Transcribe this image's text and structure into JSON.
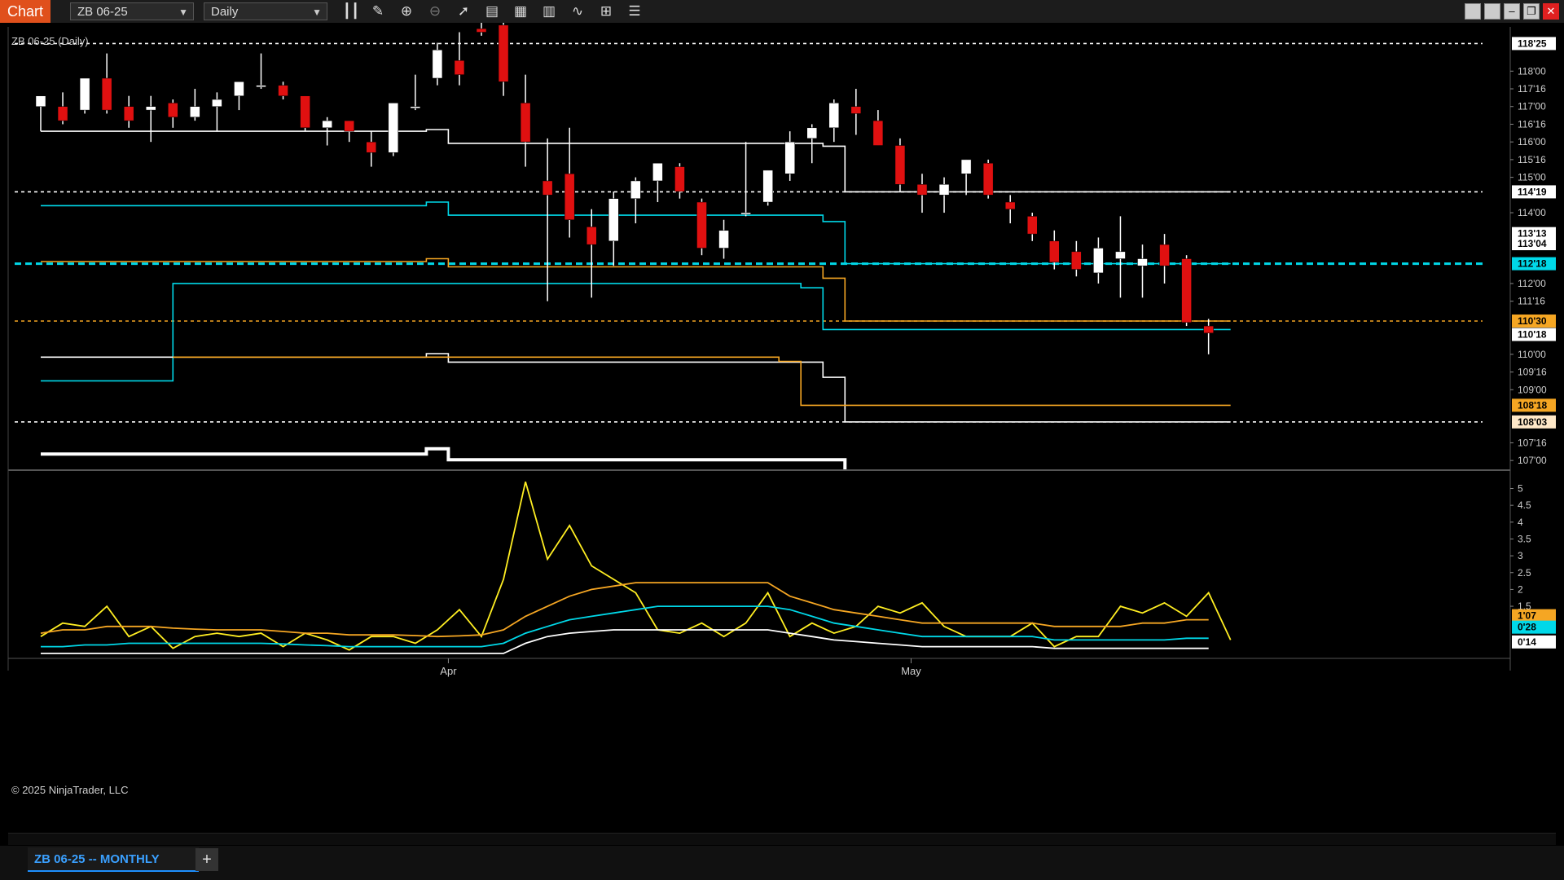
{
  "toolbar": {
    "chart_label": "Chart",
    "instrument": "ZB 06-25",
    "interval": "Daily",
    "icons": [
      "bar-type-icon",
      "draw-pencil-icon",
      "zoom-in-icon",
      "zoom-out-icon",
      "pointer-icon",
      "data-box-icon",
      "properties-icon",
      "strategies-icon",
      "indicators-icon",
      "list-icon"
    ]
  },
  "chart": {
    "title": "ZB 06-25 (Daily)",
    "copyright": "© 2025 NinjaTrader, LLC",
    "x_labels": [
      {
        "label": "Apr",
        "bar": 18.5
      },
      {
        "label": "May",
        "bar": 39.5
      }
    ],
    "price_ticks": [
      "118'00",
      "117'16",
      "117'00",
      "116'16",
      "116'00",
      "115'16",
      "115'00",
      "114'00",
      "112'00",
      "111'16",
      "110'00",
      "109'16",
      "109'00",
      "107'16",
      "107'00"
    ],
    "price_tick_values": [
      118.0,
      117.5,
      117.0,
      116.5,
      116.0,
      115.5,
      115.0,
      114.0,
      112.0,
      111.5,
      110.0,
      109.5,
      109.0,
      107.5,
      107.0
    ],
    "price_badges": [
      {
        "label": "118'25",
        "value": 118.78,
        "color": "#ffffff"
      },
      {
        "label": "114'19",
        "value": 114.59,
        "color": "#ffffff"
      },
      {
        "label": "113'13",
        "value": 113.41,
        "color": "#ffffff"
      },
      {
        "label": "113'04",
        "value": 113.125,
        "color": "#ffffff"
      },
      {
        "label": "112'18",
        "value": 112.56,
        "color": "#00d8e8"
      },
      {
        "label": "110'30",
        "value": 110.94,
        "color": "#f5a623"
      },
      {
        "label": "110'18",
        "value": 110.56,
        "color": "#ffffff"
      },
      {
        "label": "108'18",
        "value": 108.56,
        "color": "#f5a623"
      },
      {
        "label": "108'03",
        "value": 108.09,
        "color": "#ffe8c8"
      }
    ],
    "indicator_ticks": [
      "5",
      "4.5",
      "4",
      "3.5",
      "3",
      "2.5",
      "2",
      "1.5"
    ],
    "indicator_tick_values": [
      5,
      4.5,
      4,
      3.5,
      3,
      2.5,
      2,
      1.5
    ],
    "indicator_badges": [
      {
        "label": "1'07",
        "value": 1.22,
        "color": "#f5a623"
      },
      {
        "label": "0'28",
        "value": 0.88,
        "color": "#00d8e8"
      },
      {
        "label": "0'14",
        "value": 0.44,
        "color": "#ffffff"
      }
    ],
    "colors": {
      "up": "#ffffff",
      "down": "#e01010",
      "cyan": "#00d8e8",
      "orange": "#f5a623",
      "yellow": "#ffee22"
    }
  },
  "chart_data": {
    "type": "candlestick",
    "instrument": "ZB 06-25",
    "interval": "Daily",
    "price_axis_range": [
      106.75,
      119.25
    ],
    "indicator_axis_range": [
      0.0,
      5.4
    ],
    "candles": [
      {
        "o": 117.0,
        "h": 117.3,
        "l": 116.3,
        "c": 117.3
      },
      {
        "o": 117.0,
        "h": 117.4,
        "l": 116.5,
        "c": 116.6
      },
      {
        "o": 116.9,
        "h": 117.8,
        "l": 116.8,
        "c": 117.8
      },
      {
        "o": 117.8,
        "h": 118.5,
        "l": 116.8,
        "c": 116.9
      },
      {
        "o": 117.0,
        "h": 117.3,
        "l": 116.4,
        "c": 116.6
      },
      {
        "o": 116.9,
        "h": 117.3,
        "l": 116.0,
        "c": 117.0
      },
      {
        "o": 117.1,
        "h": 117.2,
        "l": 116.4,
        "c": 116.7
      },
      {
        "o": 116.7,
        "h": 117.5,
        "l": 116.6,
        "c": 117.0
      },
      {
        "o": 117.0,
        "h": 117.4,
        "l": 116.3,
        "c": 117.2
      },
      {
        "o": 117.3,
        "h": 117.7,
        "l": 116.9,
        "c": 117.7
      },
      {
        "o": 117.6,
        "h": 118.5,
        "l": 117.5,
        "c": 117.6
      },
      {
        "o": 117.6,
        "h": 117.7,
        "l": 117.2,
        "c": 117.3
      },
      {
        "o": 117.3,
        "h": 117.3,
        "l": 116.3,
        "c": 116.4
      },
      {
        "o": 116.4,
        "h": 116.7,
        "l": 115.9,
        "c": 116.6
      },
      {
        "o": 116.6,
        "h": 116.6,
        "l": 116.0,
        "c": 116.3
      },
      {
        "o": 116.0,
        "h": 116.3,
        "l": 115.3,
        "c": 115.7
      },
      {
        "o": 115.7,
        "h": 117.1,
        "l": 115.6,
        "c": 117.1
      },
      {
        "o": 117.0,
        "h": 117.9,
        "l": 116.9,
        "c": 117.0
      },
      {
        "o": 117.8,
        "h": 118.8,
        "l": 117.6,
        "c": 118.6
      },
      {
        "o": 118.3,
        "h": 119.1,
        "l": 117.6,
        "c": 117.9
      },
      {
        "o": 119.2,
        "h": 119.7,
        "l": 119.0,
        "c": 119.1
      },
      {
        "o": 119.3,
        "h": 119.6,
        "l": 117.3,
        "c": 117.7
      },
      {
        "o": 117.1,
        "h": 117.9,
        "l": 115.3,
        "c": 116.0
      },
      {
        "o": 114.9,
        "h": 116.1,
        "l": 111.5,
        "c": 114.5
      },
      {
        "o": 115.1,
        "h": 116.4,
        "l": 113.3,
        "c": 113.8
      },
      {
        "o": 113.6,
        "h": 114.1,
        "l": 111.6,
        "c": 113.1
      },
      {
        "o": 113.2,
        "h": 114.6,
        "l": 112.5,
        "c": 114.4
      },
      {
        "o": 114.4,
        "h": 115.0,
        "l": 113.7,
        "c": 114.9
      },
      {
        "o": 114.9,
        "h": 115.4,
        "l": 114.3,
        "c": 115.4
      },
      {
        "o": 115.3,
        "h": 115.4,
        "l": 114.4,
        "c": 114.6
      },
      {
        "o": 114.3,
        "h": 114.4,
        "l": 112.8,
        "c": 113.0
      },
      {
        "o": 113.0,
        "h": 113.8,
        "l": 112.7,
        "c": 113.5
      },
      {
        "o": 114.0,
        "h": 116.0,
        "l": 113.9,
        "c": 114.0
      },
      {
        "o": 114.3,
        "h": 115.2,
        "l": 114.2,
        "c": 115.2
      },
      {
        "o": 115.1,
        "h": 116.3,
        "l": 114.9,
        "c": 116.0
      },
      {
        "o": 116.1,
        "h": 116.5,
        "l": 115.4,
        "c": 116.4
      },
      {
        "o": 116.4,
        "h": 117.2,
        "l": 116.0,
        "c": 117.1
      },
      {
        "o": 117.0,
        "h": 117.5,
        "l": 116.2,
        "c": 116.8
      },
      {
        "o": 116.6,
        "h": 116.9,
        "l": 115.9,
        "c": 115.9
      },
      {
        "o": 115.9,
        "h": 116.1,
        "l": 114.6,
        "c": 114.8
      },
      {
        "o": 114.8,
        "h": 115.1,
        "l": 114.0,
        "c": 114.5
      },
      {
        "o": 114.5,
        "h": 115.0,
        "l": 114.0,
        "c": 114.8
      },
      {
        "o": 115.1,
        "h": 115.5,
        "l": 114.5,
        "c": 115.5
      },
      {
        "o": 115.4,
        "h": 115.5,
        "l": 114.4,
        "c": 114.5
      },
      {
        "o": 114.3,
        "h": 114.5,
        "l": 113.7,
        "c": 114.1
      },
      {
        "o": 113.9,
        "h": 114.0,
        "l": 113.2,
        "c": 113.4
      },
      {
        "o": 113.2,
        "h": 113.5,
        "l": 112.4,
        "c": 112.6
      },
      {
        "o": 112.9,
        "h": 113.2,
        "l": 112.2,
        "c": 112.4
      },
      {
        "o": 112.3,
        "h": 113.3,
        "l": 112.0,
        "c": 113.0
      },
      {
        "o": 112.7,
        "h": 113.9,
        "l": 111.6,
        "c": 112.9
      },
      {
        "o": 112.5,
        "h": 113.1,
        "l": 111.6,
        "c": 112.7
      },
      {
        "o": 113.1,
        "h": 113.4,
        "l": 112.0,
        "c": 112.5
      },
      {
        "o": 112.7,
        "h": 112.8,
        "l": 110.8,
        "c": 110.9
      },
      {
        "o": 110.8,
        "h": 111.0,
        "l": 110.0,
        "c": 110.6
      }
    ],
    "level_lines": [
      {
        "name": "white-level-1",
        "color": "#ffffff",
        "dashed": false,
        "points": [
          [
            0,
            116.3
          ],
          [
            17.5,
            116.3
          ],
          [
            17.5,
            116.35
          ],
          [
            18.5,
            116.35
          ],
          [
            18.5,
            115.96
          ],
          [
            33.5,
            115.96
          ],
          [
            33.5,
            115.96
          ],
          [
            35.5,
            115.96
          ],
          [
            35.5,
            115.88
          ],
          [
            36.5,
            115.88
          ],
          [
            36.5,
            114.59
          ],
          [
            54,
            114.59
          ]
        ]
      },
      {
        "name": "white-dashed-top",
        "color": "#ffffff",
        "dashed": true,
        "points": [
          [
            -1,
            118.78
          ],
          [
            54,
            118.78
          ]
        ]
      },
      {
        "name": "white-dashed-114",
        "color": "#ffffff",
        "dashed": true,
        "points": [
          [
            -1,
            114.59
          ],
          [
            54,
            114.59
          ]
        ]
      },
      {
        "name": "white-dashed-108",
        "color": "#ffffff",
        "dashed": true,
        "points": [
          [
            -1,
            108.09
          ],
          [
            54,
            108.09
          ]
        ]
      },
      {
        "name": "orange-dashed-110",
        "color": "#f5a623",
        "dashed": true,
        "points": [
          [
            -1,
            110.94
          ],
          [
            54,
            110.94
          ]
        ]
      },
      {
        "name": "cyan-dashed-112",
        "color": "#00d8e8",
        "dashed": true,
        "points": [
          [
            -1,
            112.56
          ],
          [
            54,
            112.56
          ]
        ]
      },
      {
        "name": "cyan-level-1",
        "color": "#00d8e8",
        "dashed": false,
        "points": [
          [
            0,
            114.2
          ],
          [
            17.5,
            114.2
          ],
          [
            17.5,
            114.3
          ],
          [
            18.5,
            114.3
          ],
          [
            18.5,
            113.93
          ],
          [
            35.5,
            113.93
          ],
          [
            35.5,
            113.75
          ],
          [
            36.5,
            113.75
          ],
          [
            36.5,
            112.56
          ],
          [
            54,
            112.56
          ]
        ]
      },
      {
        "name": "cyan-level-2",
        "color": "#00d8e8",
        "dashed": false,
        "points": [
          [
            0,
            109.25
          ],
          [
            6,
            109.25
          ],
          [
            6,
            112.0
          ],
          [
            34.5,
            112.0
          ],
          [
            34.5,
            111.88
          ],
          [
            35.5,
            111.88
          ],
          [
            35.5,
            110.7
          ],
          [
            54,
            110.7
          ]
        ]
      },
      {
        "name": "orange-level-1",
        "color": "#f5a623",
        "dashed": false,
        "points": [
          [
            0,
            112.62
          ],
          [
            17.5,
            112.62
          ],
          [
            17.5,
            112.7
          ],
          [
            18.5,
            112.7
          ],
          [
            18.5,
            112.47
          ],
          [
            35.5,
            112.47
          ],
          [
            35.5,
            112.15
          ],
          [
            36.5,
            112.15
          ],
          [
            36.5,
            110.94
          ],
          [
            54,
            110.94
          ]
        ]
      },
      {
        "name": "white-level-2",
        "color": "#ffffff",
        "dashed": false,
        "points": [
          [
            0,
            109.92
          ],
          [
            17.5,
            109.92
          ],
          [
            17.5,
            110.02
          ],
          [
            18.5,
            110.02
          ],
          [
            18.5,
            109.78
          ],
          [
            35.5,
            109.78
          ],
          [
            35.5,
            109.35
          ],
          [
            36.5,
            109.35
          ],
          [
            36.5,
            108.09
          ],
          [
            54,
            108.09
          ]
        ]
      },
      {
        "name": "orange-level-2",
        "color": "#f5a623",
        "dashed": false,
        "points": [
          [
            6,
            109.92
          ],
          [
            33.5,
            109.92
          ],
          [
            33.5,
            109.8
          ],
          [
            34.5,
            109.8
          ],
          [
            34.5,
            108.56
          ],
          [
            54,
            108.56
          ]
        ]
      },
      {
        "name": "thick-white-bottom",
        "color": "#ffffff",
        "dashed": false,
        "points": [
          [
            0,
            107.18
          ],
          [
            17.5,
            107.18
          ],
          [
            17.5,
            107.33
          ],
          [
            18.5,
            107.33
          ],
          [
            18.5,
            107.02
          ],
          [
            36.5,
            107.02
          ],
          [
            36.5,
            106.75
          ]
        ]
      }
    ],
    "indicator_series": [
      {
        "name": "yellow",
        "color": "#ffee22",
        "values": [
          0.6,
          1.0,
          0.9,
          1.5,
          0.6,
          0.9,
          0.25,
          0.6,
          0.7,
          0.6,
          0.7,
          0.3,
          0.7,
          0.5,
          0.2,
          0.6,
          0.6,
          0.4,
          0.8,
          1.4,
          0.6,
          2.3,
          5.2,
          2.9,
          3.9,
          2.7,
          2.3,
          1.9,
          0.8,
          0.7,
          1.0,
          0.6,
          1.0,
          1.9,
          0.6,
          1.0,
          0.7,
          0.9,
          1.5,
          1.3,
          1.6,
          0.9,
          0.6,
          0.6,
          0.6,
          1.0,
          0.3,
          0.6,
          0.6,
          1.5,
          1.3,
          1.6,
          1.2,
          1.9,
          0.5
        ]
      },
      {
        "name": "orange",
        "color": "#f5a623",
        "values": [
          0.7,
          0.8,
          0.8,
          0.9,
          0.9,
          0.9,
          0.85,
          0.82,
          0.8,
          0.8,
          0.8,
          0.75,
          0.7,
          0.7,
          0.65,
          0.65,
          0.65,
          0.63,
          0.6,
          0.62,
          0.65,
          0.8,
          1.2,
          1.5,
          1.8,
          2.0,
          2.1,
          2.2,
          2.2,
          2.2,
          2.2,
          2.2,
          2.2,
          2.2,
          1.8,
          1.6,
          1.4,
          1.3,
          1.2,
          1.1,
          1.0,
          1.0,
          1.0,
          1.0,
          1.0,
          1.0,
          0.9,
          0.9,
          0.9,
          0.9,
          1.0,
          1.0,
          1.1,
          1.1
        ]
      },
      {
        "name": "cyan",
        "color": "#00d8e8",
        "values": [
          0.3,
          0.3,
          0.35,
          0.35,
          0.4,
          0.4,
          0.4,
          0.4,
          0.4,
          0.4,
          0.4,
          0.38,
          0.35,
          0.33,
          0.3,
          0.3,
          0.3,
          0.3,
          0.3,
          0.3,
          0.3,
          0.4,
          0.7,
          0.9,
          1.1,
          1.2,
          1.3,
          1.4,
          1.5,
          1.5,
          1.5,
          1.5,
          1.5,
          1.5,
          1.4,
          1.2,
          1.0,
          0.9,
          0.8,
          0.7,
          0.6,
          0.6,
          0.6,
          0.6,
          0.6,
          0.6,
          0.5,
          0.5,
          0.5,
          0.5,
          0.5,
          0.5,
          0.55,
          0.55
        ]
      },
      {
        "name": "white",
        "color": "#ffffff",
        "values": [
          0.1,
          0.1,
          0.1,
          0.1,
          0.1,
          0.1,
          0.1,
          0.1,
          0.1,
          0.1,
          0.1,
          0.1,
          0.1,
          0.1,
          0.1,
          0.1,
          0.1,
          0.1,
          0.1,
          0.1,
          0.1,
          0.1,
          0.4,
          0.6,
          0.7,
          0.75,
          0.8,
          0.8,
          0.8,
          0.8,
          0.8,
          0.8,
          0.8,
          0.8,
          0.7,
          0.6,
          0.5,
          0.45,
          0.4,
          0.35,
          0.3,
          0.3,
          0.3,
          0.3,
          0.3,
          0.3,
          0.25,
          0.25,
          0.25,
          0.25,
          0.25,
          0.25,
          0.25,
          0.25
        ]
      }
    ]
  },
  "tabs": [
    {
      "label": "ZB 06-25 -- MONTHLY"
    }
  ]
}
